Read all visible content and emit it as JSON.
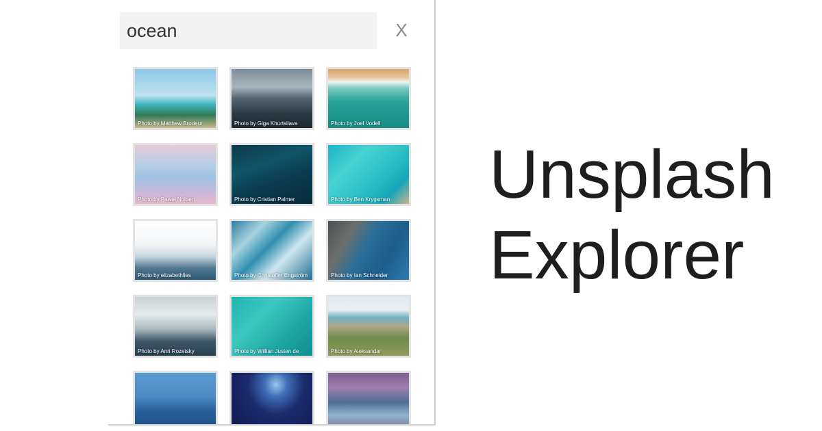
{
  "search": {
    "value": "ocean",
    "close_label": "X"
  },
  "photos": [
    {
      "credit": "Photo by Matthew Brodeur",
      "bg": "linear-gradient(180deg,#8ec7e8 0%,#bfe3ef 45%,#3fb3c2 60%,#2f7a54 78%,#c8b98c 100%)"
    },
    {
      "credit": "Photo by Giga Khurtsilava",
      "bg": "linear-gradient(180deg,#7d8d99 0%,#a9b5bd 30%,#55646f 50%,#2c3a44 75%,#1d2830 100%)"
    },
    {
      "credit": "Photo by Joel Vodell",
      "bg": "linear-gradient(180deg,#d9a36c 0%,#e9c39a 14%,#f1f4f2 22%,#7ccbbf 32%,#28a39a 55%,#168b84 100%)"
    },
    {
      "credit": "Photo by Paweł Nolbert",
      "bg": "linear-gradient(180deg,#e9c9d6 0%,#b9cfe7 30%,#9fc2e3 55%,#c7b8d9 80%,#e8b9cc 100%)"
    },
    {
      "credit": "Photo by Cristian Palmer",
      "bg": "linear-gradient(160deg,#0e3a4c 0%,#11546a 35%,#0a3c50 60%,#062b3a 100%)"
    },
    {
      "credit": "Photo by Ben Krygsman",
      "bg": "linear-gradient(135deg,#1ab5c6 0%,#46d2d3 30%,#2fc2c8 55%,#16a6b8 80%,#c8b48e 100%)"
    },
    {
      "credit": "Photo by elizabethlies",
      "bg": "linear-gradient(180deg,#ffffff 0%,#f3f6f8 40%,#c9d6df 60%,#4f7891 80%,#2e5a73 100%)"
    },
    {
      "credit": "Photo by Christoffer Engström",
      "bg": "linear-gradient(135deg,#2e7fa3 0%,#a7d3df 25%,#2f8eb0 45%,#cfe7ee 65%,#1f6f93 100%)"
    },
    {
      "credit": "Photo by Ian Schneider",
      "bg": "linear-gradient(120deg,#4a5055 0%,#6c6f6a 25%,#2b6f9a 45%,#1d5d8b 70%,#2d7bb0 100%)"
    },
    {
      "credit": "Photo by Anri Rozetsky",
      "bg": "linear-gradient(180deg,#c9d1d4 0%,#e6ebec 30%,#a9b7bd 55%,#3f5765 75%,#27404f 100%)"
    },
    {
      "credit": "Photo by Willian Justen de",
      "bg": "linear-gradient(135deg,#22b3b0 0%,#3cc8c0 35%,#1fa8a7 65%,#118e91 100%)"
    },
    {
      "credit": "Photo by Aleksandar",
      "bg": "linear-gradient(180deg,#dfe9ef 0%,#e9eff2 22%,#6fb3c2 35%,#b0a787 50%,#6f8c4a 70%,#8f9a5c 100%)"
    },
    {
      "credit": "",
      "bg": "linear-gradient(180deg,#5b9bd0 0%,#4b8ac3 40%,#2a5f9a 65%,#1e4b7e 100%)"
    },
    {
      "credit": "",
      "bg": "radial-gradient(ellipse at 55% 20%,#9cc6ec 0%,#3f6fb6 18%,#1a2a6b 45%,#0f1850 100%)"
    },
    {
      "credit": "",
      "bg": "linear-gradient(180deg,#7b5f8e 0%,#9e7db0 25%,#4f6f98 50%,#8fb3cf 72%,#7c6f88 100%)"
    }
  ],
  "hero": {
    "line1": "Unsplash",
    "line2": "Explorer"
  }
}
